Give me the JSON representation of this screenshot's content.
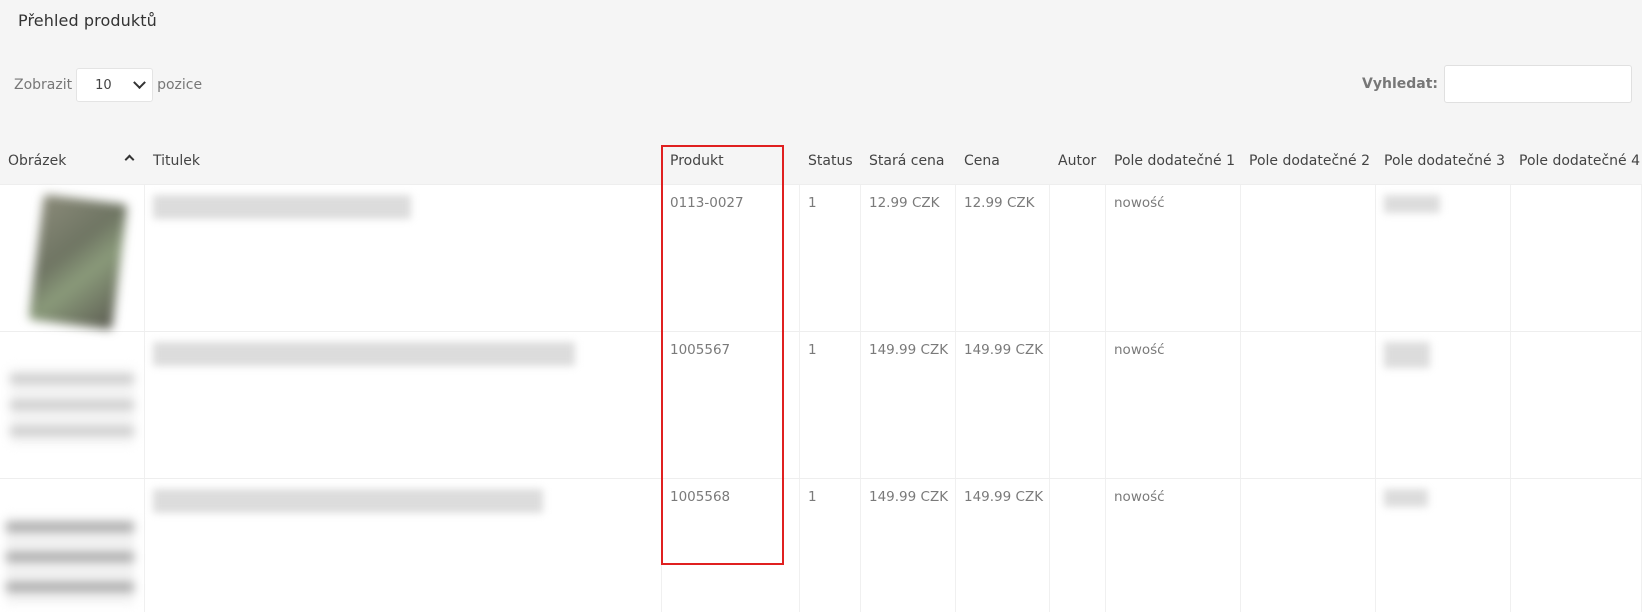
{
  "page": {
    "title": "Přehled produktů"
  },
  "length": {
    "prefix": "Zobrazit",
    "value": "10",
    "suffix": "pozice"
  },
  "search": {
    "label": "Vyhledat:",
    "value": ""
  },
  "columns": [
    "Obrázek",
    "Titulek",
    "Produkt",
    "Status",
    "Stará cena",
    "Cena",
    "Autor",
    "Pole dodatečné 1",
    "Pole dodatečné 2",
    "Pole dodatečné 3",
    "Pole dodatečné 4"
  ],
  "rows": [
    {
      "produkt": "0113-0027",
      "status": "1",
      "stara_cena": "12.99 CZK",
      "cena": "12.99 CZK",
      "autor": "",
      "pole1": "nowość",
      "pole2": "",
      "pole4": ""
    },
    {
      "produkt": "1005567",
      "status": "1",
      "stara_cena": "149.99 CZK",
      "cena": "149.99 CZK",
      "autor": "",
      "pole1": "nowość",
      "pole2": "",
      "pole4": ""
    },
    {
      "produkt": "1005568",
      "status": "1",
      "stara_cena": "149.99 CZK",
      "cena": "149.99 CZK",
      "autor": "",
      "pole1": "nowość",
      "pole2": "",
      "pole4": ""
    }
  ],
  "colors": {
    "highlight": "#e02020",
    "header_bg": "#f5f5f5",
    "row_bg": "#ffffff"
  },
  "icons": {
    "sort": "chevron-up-icon",
    "select": "chevron-down-icon"
  }
}
